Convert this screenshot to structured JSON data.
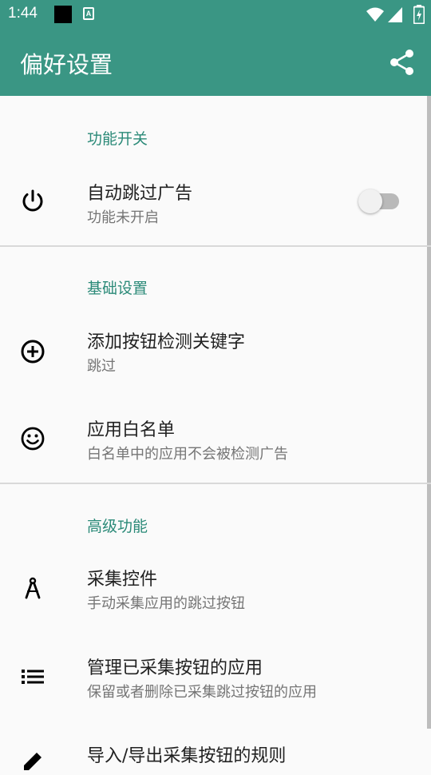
{
  "status_bar": {
    "time": "1:44",
    "notif_letter": "A",
    "icons": [
      "notification-black-icon",
      "notification-a-icon",
      "wifi-icon",
      "signal-icon",
      "battery-charging-icon"
    ]
  },
  "app_bar": {
    "title": "偏好设置",
    "action_icon": "share-icon",
    "color": "#3a9684"
  },
  "accent_color": "#2b8a78",
  "sections": [
    {
      "header": "功能开关",
      "items": [
        {
          "icon": "power-icon",
          "title": "自动跳过广告",
          "subtitle": "功能未开启",
          "toggle": false
        }
      ]
    },
    {
      "header": "基础设置",
      "items": [
        {
          "icon": "add-circle-icon",
          "title": "添加按钮检测关键字",
          "subtitle": "跳过"
        },
        {
          "icon": "smiley-icon",
          "title": "应用白名单",
          "subtitle": "白名单中的应用不会被检测广告"
        }
      ]
    },
    {
      "header": "高级功能",
      "items": [
        {
          "icon": "compass-icon",
          "title": "采集控件",
          "subtitle": "手动采集应用的跳过按钮"
        },
        {
          "icon": "list-icon",
          "title": "管理已采集按钮的应用",
          "subtitle": "保留或者删除已采集跳过按钮的应用"
        },
        {
          "icon": "edit-icon",
          "title": "导入/导出采集按钮的规则"
        }
      ]
    }
  ]
}
